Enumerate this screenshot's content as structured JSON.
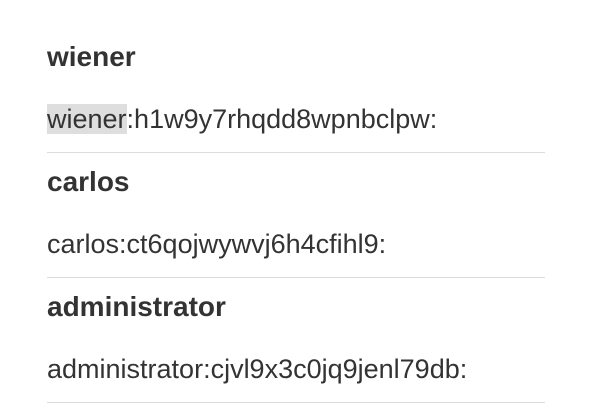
{
  "entries": [
    {
      "username": "wiener",
      "credential_user": "wiener",
      "credential_rest": ":h1w9y7rhqdd8wpnbclpw:",
      "highlighted": true
    },
    {
      "username": "carlos",
      "credential_user": "carlos",
      "credential_rest": ":ct6qojwywvj6h4cfihl9:",
      "highlighted": false
    },
    {
      "username": "administrator",
      "credential_user": "administrator",
      "credential_rest": ":cjvl9x3c0jq9jenl79db:",
      "highlighted": false
    }
  ],
  "colors": {
    "text": "#333333",
    "divider": "#dcdcdc",
    "highlight": "#dedede"
  }
}
